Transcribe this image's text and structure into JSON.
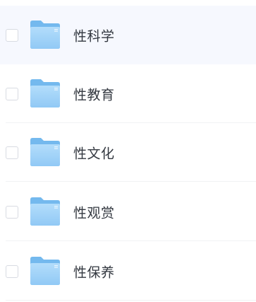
{
  "file_list": {
    "items": [
      {
        "name": "性科学",
        "checked": false,
        "highlighted": true
      },
      {
        "name": "性教育",
        "checked": false,
        "highlighted": false
      },
      {
        "name": "性文化",
        "checked": false,
        "highlighted": false
      },
      {
        "name": "性观赏",
        "checked": false,
        "highlighted": false
      },
      {
        "name": "性保养",
        "checked": false,
        "highlighted": false
      }
    ],
    "icon": "folder-icon",
    "colors": {
      "highlight_background": "#f6f8fe",
      "folder_back": "#74b9ee",
      "folder_front_light": "#b3ddfb",
      "folder_front_dark": "#91c9f5",
      "text": "#333840",
      "checkbox_border": "#d8dbe2",
      "divider": "#f1f2f4"
    }
  }
}
